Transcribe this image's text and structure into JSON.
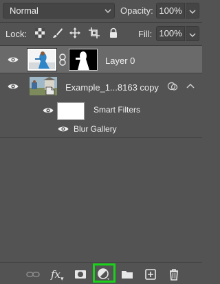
{
  "header": {
    "blend_mode": "Normal",
    "opacity_label": "Opacity:",
    "opacity_value": "100%",
    "lock_label": "Lock:",
    "fill_label": "Fill:",
    "fill_value": "100%"
  },
  "layers": [
    {
      "name": "Layer 0",
      "selected": true,
      "visible": true
    },
    {
      "name": "Example_1...8163 copy",
      "selected": false,
      "visible": true
    }
  ],
  "smart_filters": {
    "label": "Smart Filters",
    "filter": "Blur Gallery"
  },
  "toolbar": {
    "buttons": [
      "link-layers",
      "fx",
      "add-mask",
      "adjustment-layer",
      "group",
      "new-layer",
      "delete"
    ],
    "fx_label": "fx",
    "highlighted": "adjustment-layer"
  },
  "colors": {
    "panel_bg": "#535353",
    "selected_row": "#6a6a6a",
    "highlight": "#19d31a"
  }
}
